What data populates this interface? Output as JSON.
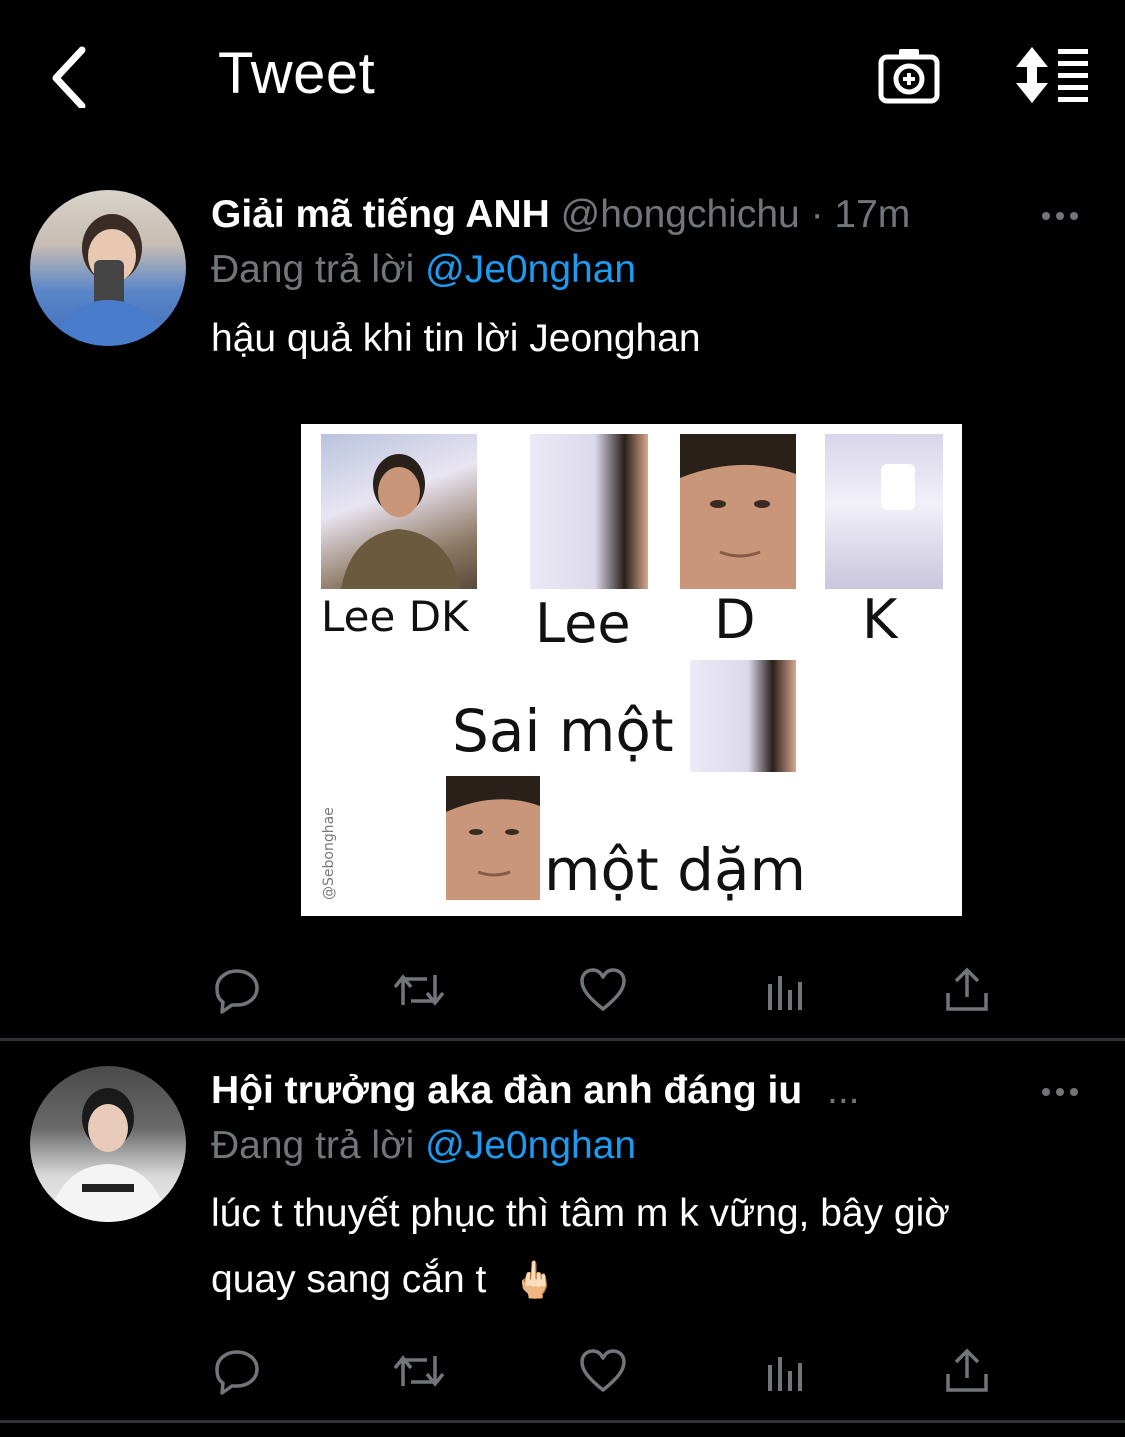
{
  "header": {
    "title": "Tweet"
  },
  "tweets": [
    {
      "name": "Giải mã tiếng ANH",
      "handle": "@hongchichu",
      "time": "· 17m",
      "reply_prefix": "Đang trả lời",
      "reply_to": "@Je0nghan",
      "text": "hậu quả khi tin lời Jeonghan",
      "meme": {
        "caption_lee_dk": "Lee DK",
        "caption_lee": "Lee",
        "caption_d": "D",
        "caption_k": "K",
        "caption_sai_mot": "Sai một",
        "caption_mot_dam": "một dặm",
        "watermark": "@Sebonghae"
      }
    },
    {
      "name": "Hội trưởng aka đàn anh đáng iu",
      "name_ellipsis": "...",
      "reply_prefix": "Đang trả lời",
      "reply_to": "@Je0nghan",
      "text_line1": "lúc t thuyết phục thì tâm m k vững, bây giờ",
      "text_line2": "quay sang cắn t",
      "emoji": "🖕🏻"
    }
  ],
  "colors": {
    "accent": "#1d9bf0",
    "muted": "#71767b",
    "divider": "#2f3336"
  }
}
